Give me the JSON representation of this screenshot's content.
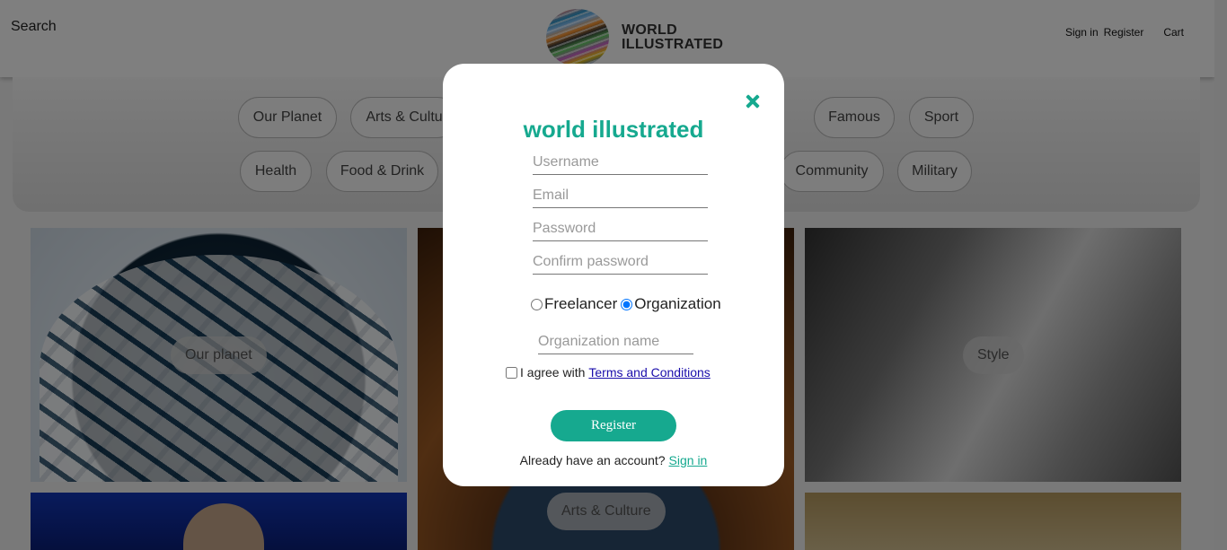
{
  "header": {
    "search_label": "Search",
    "logo_line1": "WORLD",
    "logo_line2": "ILLUSTRATED",
    "sign_in": "Sign in",
    "register": "Register",
    "cart": "Cart"
  },
  "categories": {
    "row1": [
      "Our Planet",
      "Arts & Cultu",
      "Famous",
      "Sport"
    ],
    "row2": [
      "Health",
      "Food & Drink",
      "Community",
      "Military"
    ]
  },
  "cards": {
    "planet": "Our planet",
    "arts": "Arts & Culture",
    "style": "Style"
  },
  "modal": {
    "title": "world illustrated",
    "username_placeholder": "Username",
    "email_placeholder": "Email",
    "password_placeholder": "Password",
    "confirm_placeholder": "Confirm password",
    "radio_freelancer": "Freelancer",
    "radio_organization": "Organization",
    "selected_account_type": "Organization",
    "org_placeholder": "Organization name",
    "agree_text": "I agree with",
    "terms_link": "Terms and Conditions",
    "register_button": "Register",
    "have_account": "Already have an account?",
    "sign_in_link": "Sign in"
  },
  "colors": {
    "accent": "#16a98f",
    "link": "#1a0dab"
  }
}
